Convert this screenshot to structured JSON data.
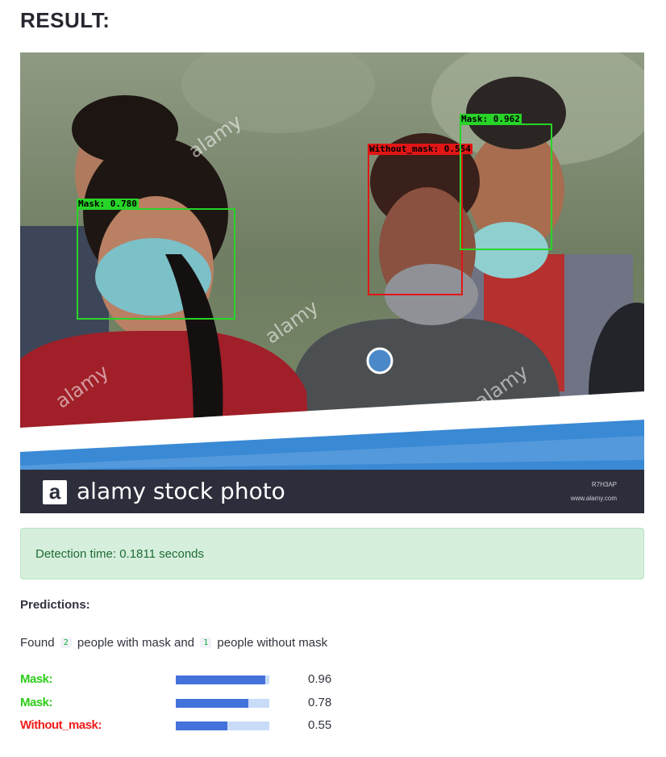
{
  "page": {
    "title": "RESULT:"
  },
  "image": {
    "detections": [
      {
        "label": "Mask: 0.780",
        "class": "mask"
      },
      {
        "label": "Without_mask: 0.554",
        "class": "nomask"
      },
      {
        "label": "Mask: 0.962",
        "class": "mask"
      }
    ],
    "watermark_text": "alamy",
    "footer": {
      "logo_letter": "a",
      "brand_text": "alamy stock photo",
      "image_id": "R7H3AP",
      "url": "www.alamy.com"
    }
  },
  "alert": {
    "text": "Detection time: 0.1811 seconds"
  },
  "predictions": {
    "heading": "Predictions:",
    "summary": {
      "prefix": "Found",
      "with_mask_count": "2",
      "middle": "people with mask and",
      "without_mask_count": "1",
      "suffix": "people without mask"
    },
    "rows": [
      {
        "label": "Mask:",
        "class": "mask",
        "value": "0.96",
        "fraction": 0.96
      },
      {
        "label": "Mask:",
        "class": "mask",
        "value": "0.78",
        "fraction": 0.78
      },
      {
        "label": "Without_mask:",
        "class": "nomask",
        "value": "0.55",
        "fraction": 0.55
      }
    ]
  },
  "colors": {
    "mask": "#28d428",
    "without_mask": "#e11616",
    "bar_fill": "#4472db",
    "bar_track": "#c8dcf8",
    "success_bg": "#d5efdc"
  }
}
